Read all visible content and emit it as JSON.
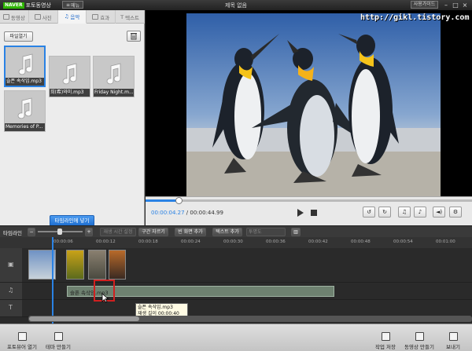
{
  "titlebar": {
    "brand": "NAVER",
    "product": "포토동영상",
    "menu_label": "메뉴",
    "title": "제목 없음",
    "guide_label": "사용가이드"
  },
  "left_panel": {
    "tabs": [
      {
        "label": "동영상"
      },
      {
        "label": "사진"
      },
      {
        "label": "음악"
      },
      {
        "label": "효과"
      },
      {
        "label": "텍스트"
      }
    ],
    "file_open_label": "파일열기",
    "media": [
      {
        "caption": "슬픈 속삭임.mp3"
      },
      {
        "caption": "희(希)와미.mp3"
      },
      {
        "caption": "Friday Night.m..."
      },
      {
        "caption": "Memories of P..."
      }
    ],
    "add_to_timeline_label": "타임라인에 넣기"
  },
  "preview": {
    "watermark": "http://gikl.tistory.com"
  },
  "playback": {
    "current_time": "00:00:04.27",
    "total_time": "00:00:44.99",
    "progress": 0.1
  },
  "timeline": {
    "label": "타임라인",
    "toolbar": {
      "minus": "−",
      "plus": "+",
      "set_playtime": "재생 시간 설정",
      "trim": "구간 자르기",
      "add_blank": "빈 화면 추가",
      "add_text": "텍스트 추가",
      "transparency": "투명도"
    },
    "ruler_ticks": [
      "00:00:06",
      "00:00:12",
      "00:00:18",
      "00:00:24",
      "00:00:30",
      "00:00:36",
      "00:00:42",
      "00:00:48",
      "00:00:54",
      "00:01:00"
    ],
    "audio_clip_label": "슬픈 속삭임.mp3",
    "tooltip": {
      "name": "슬픈 속삭임.mp3",
      "duration": "재생 길이 00:00:40"
    }
  },
  "bottom": {
    "load_photos": "포토뷰어 열기",
    "make_theme": "테마 만들기",
    "save_project": "작업 저장",
    "make_video": "동영상 만들기",
    "send": "보내기"
  },
  "colors": {
    "accent": "#2a82e4",
    "naver_green": "#2db400"
  }
}
